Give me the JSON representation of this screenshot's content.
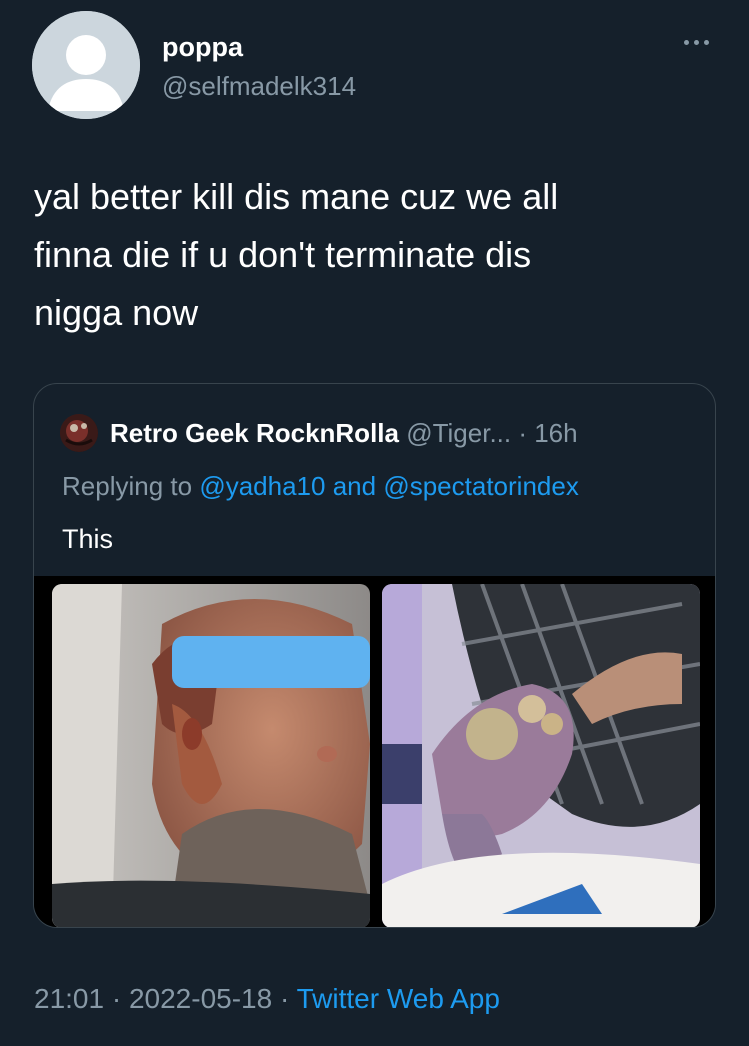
{
  "author": {
    "display_name": "poppa",
    "handle": "@selfmadelk314"
  },
  "more_icon": "more-dots-icon",
  "tweet": {
    "line1": "yal better kill dis mane cuz we all",
    "line2": "finna die if u don't terminate dis",
    "line3": "nigga now"
  },
  "quoted": {
    "display_name": "Retro Geek RocknRolla",
    "meta": "@Tiger... · 16h",
    "replying_prefix": "Replying to",
    "mention1": "@yadha10",
    "and": "and",
    "mention2": "@spectatorindex",
    "text": "This",
    "media": [
      {
        "description_icon": "photo-face-lesions"
      },
      {
        "description_icon": "photo-hand-blisters"
      }
    ]
  },
  "footer": {
    "time": "21:01",
    "sep1": "·",
    "date": "2022-05-18",
    "sep2": "·",
    "source": "Twitter Web App"
  },
  "colors": {
    "background": "#15202b",
    "secondary_text": "#8899a6",
    "link": "#1d9bf0",
    "border": "#38444d"
  }
}
